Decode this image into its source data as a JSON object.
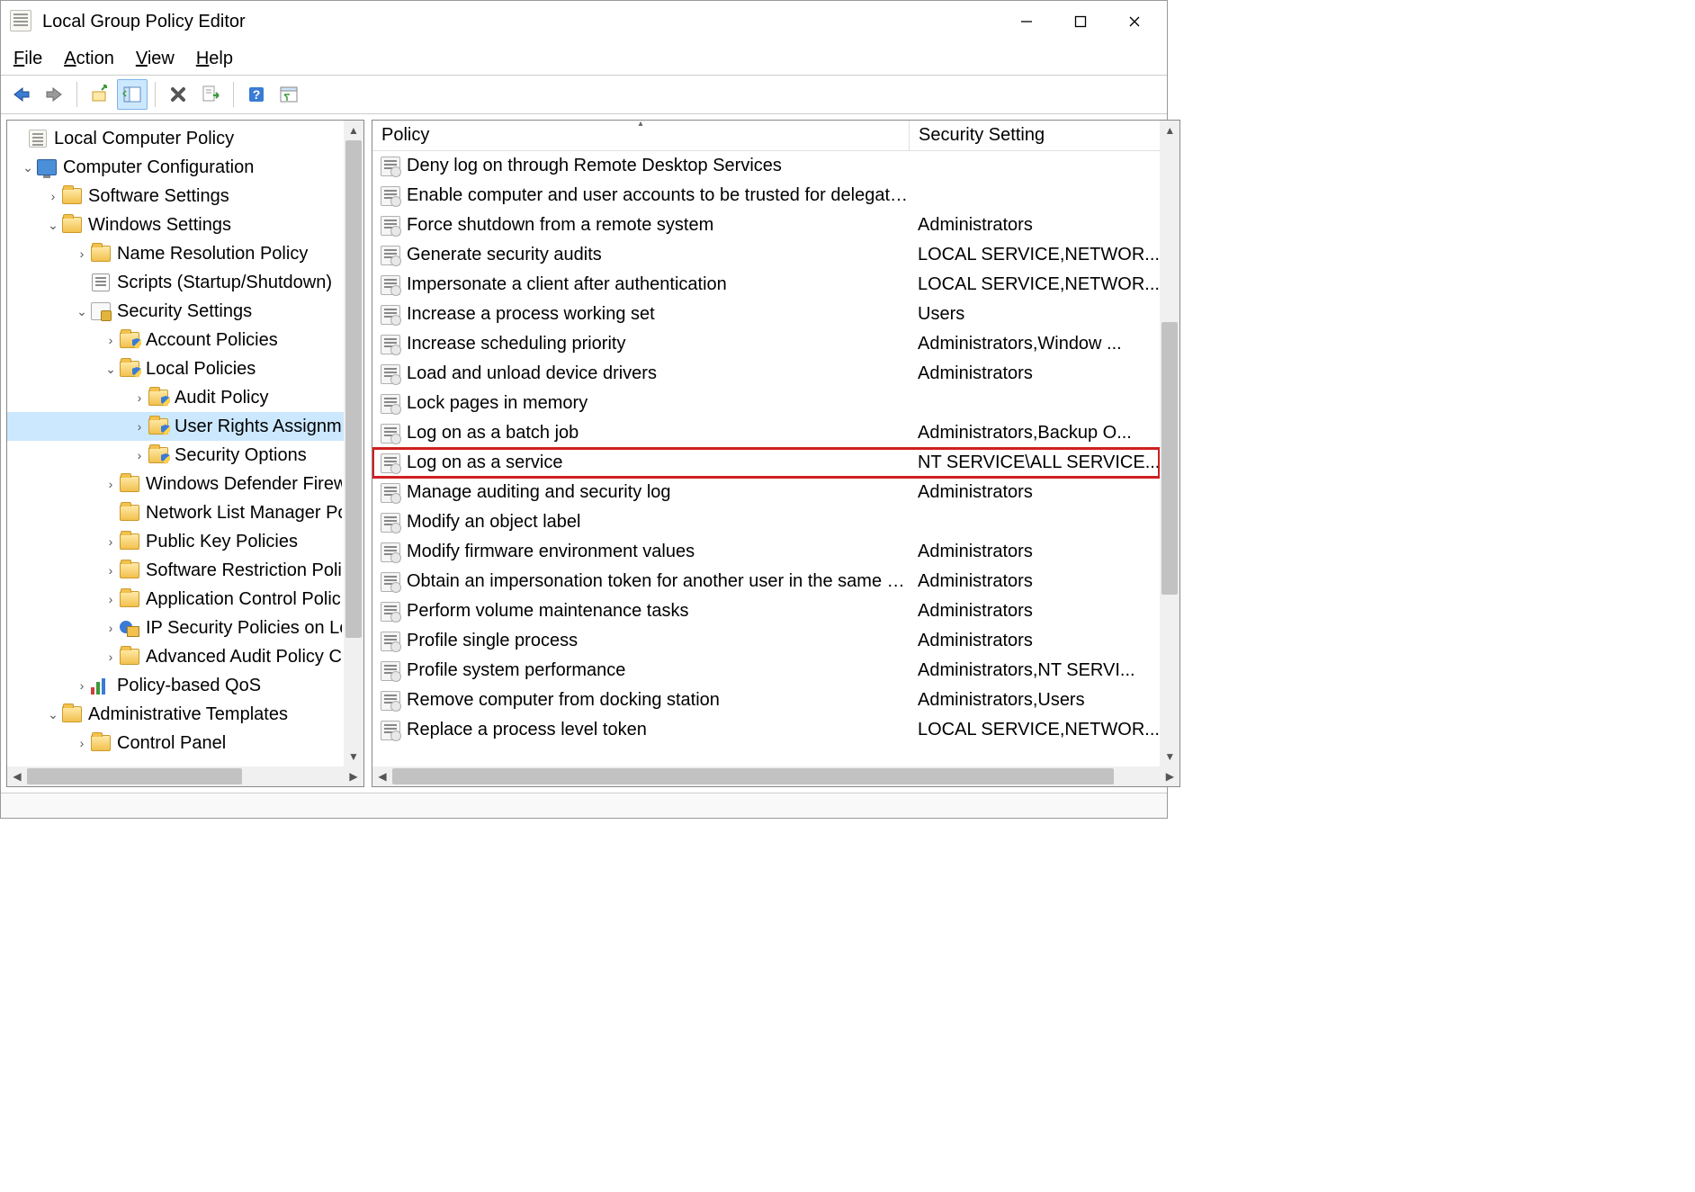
{
  "window": {
    "title": "Local Group Policy Editor"
  },
  "menu": {
    "file": "File",
    "action": "Action",
    "view": "View",
    "help": "Help"
  },
  "tree": {
    "root": "Local Computer Policy",
    "computer_config": "Computer Configuration",
    "software_settings": "Software Settings",
    "windows_settings": "Windows Settings",
    "name_resolution": "Name Resolution Policy",
    "scripts": "Scripts (Startup/Shutdown)",
    "security_settings": "Security Settings",
    "account_policies": "Account Policies",
    "local_policies": "Local Policies",
    "audit_policy": "Audit Policy",
    "user_rights": "User Rights Assignment",
    "security_options": "Security Options",
    "windows_defender": "Windows Defender Firewall with Advanced Security",
    "network_list": "Network List Manager Policies",
    "public_key": "Public Key Policies",
    "software_restriction": "Software Restriction Policies",
    "app_control": "Application Control Policies",
    "ip_security": "IP Security Policies on Local Computer",
    "advanced_audit": "Advanced Audit Policy Configuration",
    "policy_qos": "Policy-based QoS",
    "admin_templates": "Administrative Templates",
    "control_panel": "Control Panel"
  },
  "columns": {
    "policy": "Policy",
    "setting": "Security Setting"
  },
  "policies": [
    {
      "name": "Deny log on through Remote Desktop Services",
      "setting": ""
    },
    {
      "name": "Enable computer and user accounts to be trusted for delegation",
      "setting": ""
    },
    {
      "name": "Force shutdown from a remote system",
      "setting": "Administrators"
    },
    {
      "name": "Generate security audits",
      "setting": "LOCAL SERVICE,NETWOR..."
    },
    {
      "name": "Impersonate a client after authentication",
      "setting": "LOCAL SERVICE,NETWOR..."
    },
    {
      "name": "Increase a process working set",
      "setting": "Users"
    },
    {
      "name": "Increase scheduling priority",
      "setting": "Administrators,Window ..."
    },
    {
      "name": "Load and unload device drivers",
      "setting": "Administrators"
    },
    {
      "name": "Lock pages in memory",
      "setting": ""
    },
    {
      "name": "Log on as a batch job",
      "setting": "Administrators,Backup O..."
    },
    {
      "name": "Log on as a service",
      "setting": "NT SERVICE\\ALL SERVICE..."
    },
    {
      "name": "Manage auditing and security log",
      "setting": "Administrators"
    },
    {
      "name": "Modify an object label",
      "setting": ""
    },
    {
      "name": "Modify firmware environment values",
      "setting": "Administrators"
    },
    {
      "name": "Obtain an impersonation token for another user in the same se...",
      "setting": "Administrators"
    },
    {
      "name": "Perform volume maintenance tasks",
      "setting": "Administrators"
    },
    {
      "name": "Profile single process",
      "setting": "Administrators"
    },
    {
      "name": "Profile system performance",
      "setting": "Administrators,NT SERVI..."
    },
    {
      "name": "Remove computer from docking station",
      "setting": "Administrators,Users"
    },
    {
      "name": "Replace a process level token",
      "setting": "LOCAL SERVICE,NETWOR..."
    }
  ],
  "highlight_index": 10
}
